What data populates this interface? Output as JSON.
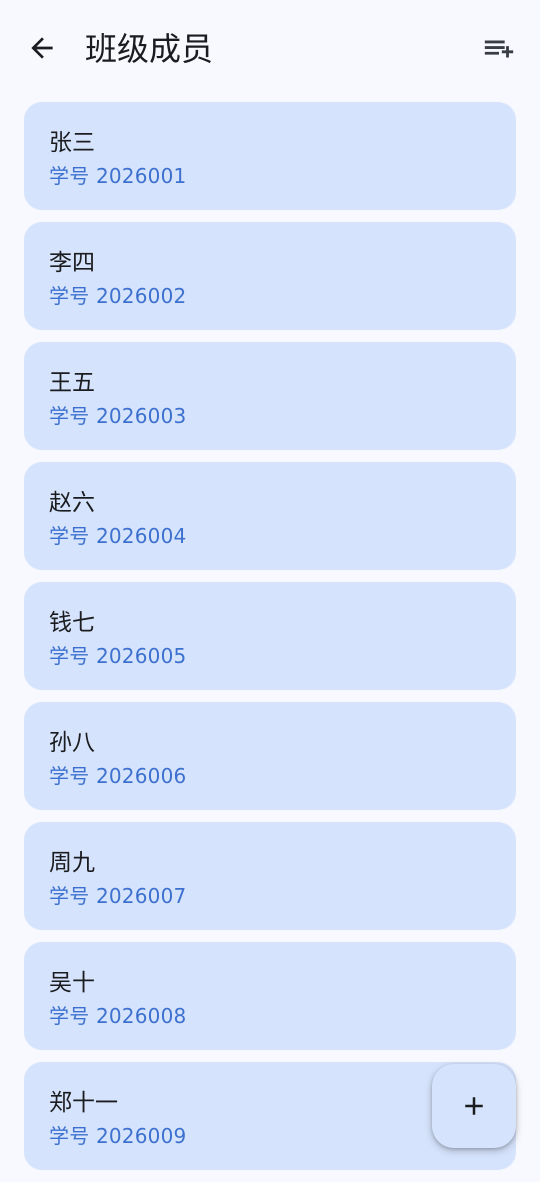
{
  "header": {
    "title": "班级成员",
    "back_icon": "arrow-left-icon",
    "add_icon": "playlist-add-icon"
  },
  "members": [
    {
      "name": "张三",
      "id": "学号 2026001"
    },
    {
      "name": "李四",
      "id": "学号 2026002"
    },
    {
      "name": "王五",
      "id": "学号 2026003"
    },
    {
      "name": "赵六",
      "id": "学号 2026004"
    },
    {
      "name": "钱七",
      "id": "学号 2026005"
    },
    {
      "name": "孙八",
      "id": "学号 2026006"
    },
    {
      "name": "周九",
      "id": "学号 2026007"
    },
    {
      "name": "吴十",
      "id": "学号 2026008"
    },
    {
      "name": "郑十一",
      "id": "学号 2026009"
    }
  ],
  "fab": {
    "icon": "plus-icon"
  },
  "colors": {
    "background": "#f7f9ff",
    "card": "#d6e3fc",
    "accent": "#3d71cf",
    "text": "#1b1c1f"
  }
}
